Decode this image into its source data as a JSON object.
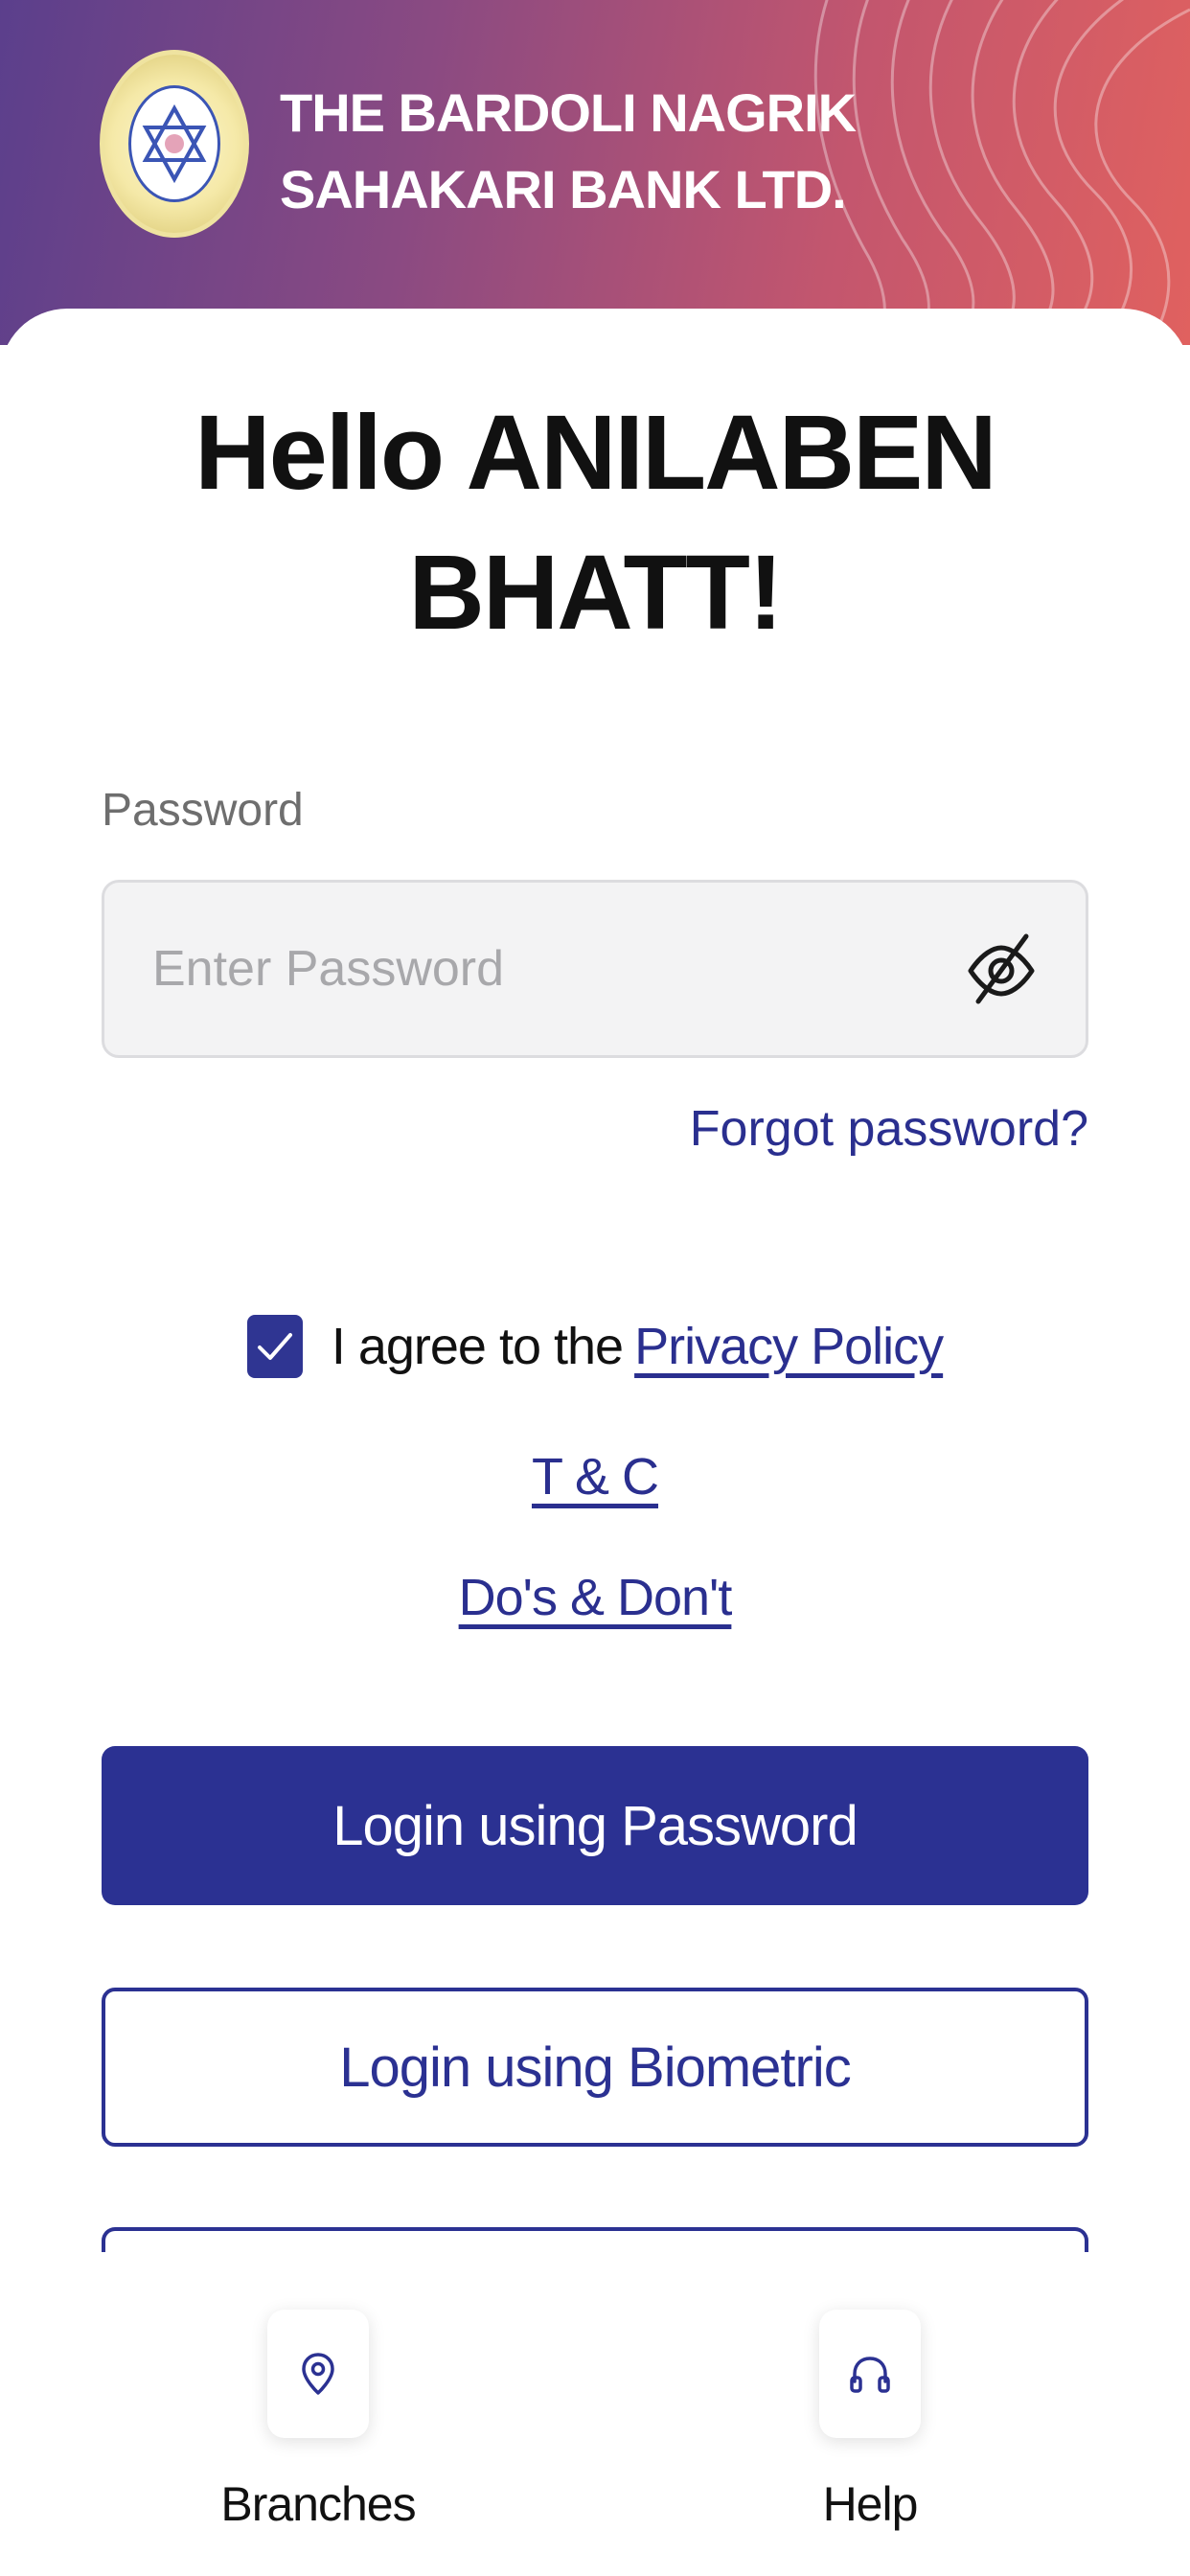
{
  "header": {
    "bank_name": "THE BARDOLI NAGRIK SAHAKARI BANK LTD.",
    "logo_icon": "bank-logo-icon"
  },
  "greeting": "Hello ANILABEN BHATT!",
  "password": {
    "label": "Password",
    "placeholder": "Enter Password",
    "value": "",
    "toggle_icon": "eye-off-icon"
  },
  "forgot_password": "Forgot password?",
  "agreement": {
    "checked": true,
    "text": "I agree to the",
    "privacy_policy": "Privacy Policy",
    "tnc": "T & C",
    "dos_donts": "Do's & Don't"
  },
  "buttons": {
    "login_password": "Login using Password",
    "login_biometric": "Login using Biometric"
  },
  "bottom_nav": {
    "branches": {
      "label": "Branches",
      "icon": "location-pin-icon"
    },
    "help": {
      "label": "Help",
      "icon": "headphones-icon"
    }
  },
  "colors": {
    "primary": "#2b3192",
    "link": "#2a2f8f",
    "header_gradient_start": "#5b3f8c",
    "header_gradient_end": "#e0615f"
  }
}
